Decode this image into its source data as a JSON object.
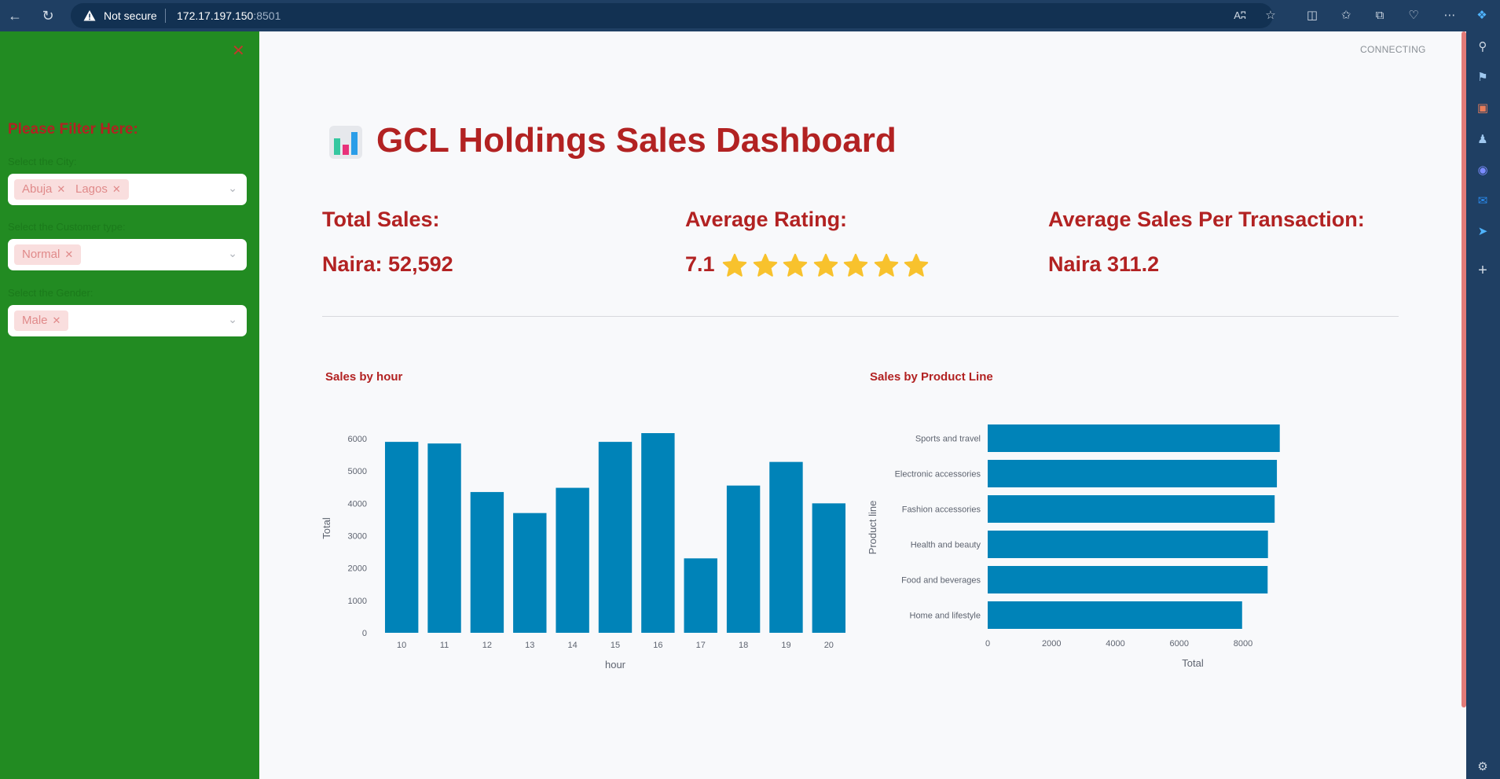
{
  "browser": {
    "security_label": "Not secure",
    "url_host": "172.17.197.150",
    "url_port": ":8501",
    "read_aloud_label": "Aʭ"
  },
  "sidebar": {
    "filter_title": "Please Filter Here:",
    "filters": [
      {
        "label": "Select the City:",
        "selected": [
          "Abuja",
          "Lagos"
        ]
      },
      {
        "label": "Select the Customer type:",
        "selected": [
          "Normal"
        ]
      },
      {
        "label": "Select the Gender:",
        "selected": [
          "Male"
        ]
      }
    ]
  },
  "status": "CONNECTING",
  "header": {
    "title": "GCL Holdings Sales Dashboard",
    "icon": "bar-chart-emoji"
  },
  "metrics": {
    "total_sales_label": "Total Sales:",
    "total_sales_value": "Naira: 52,592",
    "avg_rating_label": "Average Rating:",
    "avg_rating_value": "7.1",
    "avg_rating_stars": 7,
    "avg_per_txn_label": "Average Sales Per Transaction:",
    "avg_per_txn_value": "Naira 311.2"
  },
  "colors": {
    "accent": "#b22222",
    "sidebar_bg": "#228b22",
    "bar": "#0083b8",
    "star": "#f8c22d"
  },
  "chart_data": [
    {
      "type": "bar",
      "title": "Sales by hour",
      "xlabel": "hour",
      "ylabel": "Total",
      "categories": [
        "10",
        "11",
        "12",
        "13",
        "14",
        "15",
        "16",
        "17",
        "18",
        "19",
        "20"
      ],
      "values": [
        5900,
        5850,
        4350,
        3700,
        4480,
        5900,
        6170,
        2300,
        4550,
        5280,
        4000
      ],
      "ylim": [
        0,
        6200
      ],
      "yticks": [
        "0",
        "1000",
        "2000",
        "3000",
        "4000",
        "5000",
        "6000"
      ]
    },
    {
      "type": "bar",
      "orientation": "horizontal",
      "title": "Sales by Product Line",
      "xlabel": "Total",
      "ylabel": "Product line",
      "categories": [
        "Sports and travel",
        "Electronic accessories",
        "Fashion accessories",
        "Health and beauty",
        "Food and beverages",
        "Home and lifestyle"
      ],
      "values": [
        9150,
        9060,
        8990,
        8780,
        8770,
        7970
      ],
      "xlim": [
        0,
        9200
      ],
      "xticks": [
        "0",
        "2000",
        "4000",
        "6000",
        "8000"
      ]
    }
  ]
}
